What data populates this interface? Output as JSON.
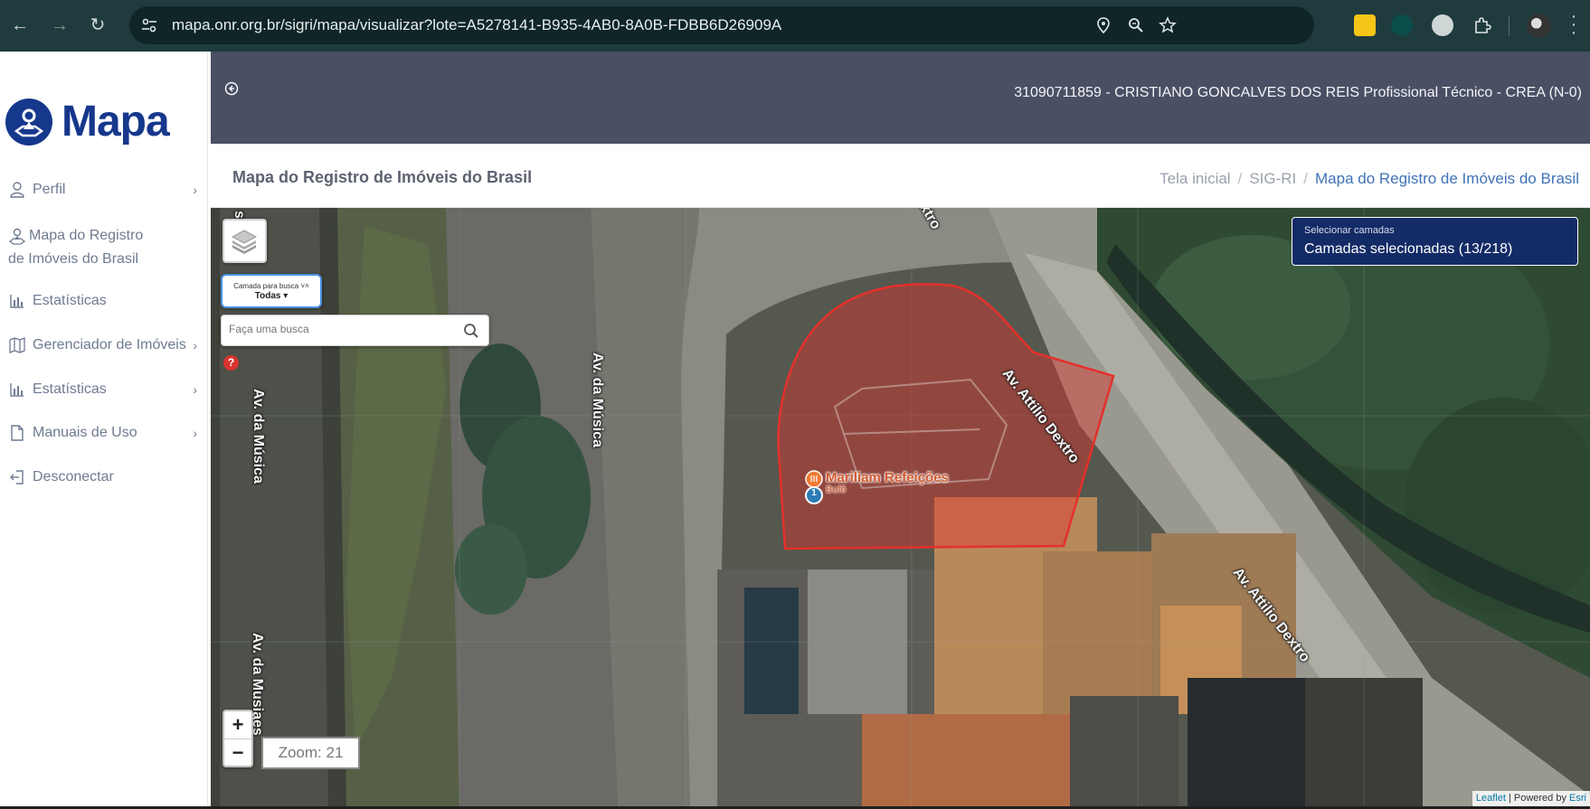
{
  "browser": {
    "url_host": "mapa.onr.org.br",
    "url_path": "/sigri/mapa/visualizar?lote=A5278141-B935-4AB0-8A0B-FDBB6D26909A"
  },
  "sidebar": {
    "logo_text": "Mapa",
    "items": [
      {
        "label": "Perfil",
        "icon": "user-icon",
        "has_chevron": true
      },
      {
        "label": "Mapa do Registro de Imóveis do Brasil",
        "icon": "map-pin-icon",
        "has_chevron": false
      },
      {
        "label": "Estatísticas",
        "icon": "bar-chart-icon",
        "has_chevron": false
      },
      {
        "label": "Gerenciador de Imóveis",
        "icon": "map-book-icon",
        "has_chevron": true
      },
      {
        "label": "Estatísticas",
        "icon": "bar-chart-icon",
        "has_chevron": true
      },
      {
        "label": "Manuais de Uso",
        "icon": "document-icon",
        "has_chevron": true
      },
      {
        "label": "Desconectar",
        "icon": "logout-icon",
        "has_chevron": false
      }
    ]
  },
  "topbar": {
    "user_info": "31090711859 - CRISTIANO GONCALVES DOS REIS Profissional Técnico - CREA (N-0)"
  },
  "header": {
    "page_title": "Mapa do Registro de Imóveis do Brasil",
    "breadcrumb": [
      "Tela inicial",
      "SIG-RI",
      "Mapa do Registro de Imóveis do Brasil"
    ]
  },
  "map": {
    "layer_select": {
      "label": "Camada para busca",
      "value": "Todas"
    },
    "search_placeholder": "Faça uma busca",
    "layers_panel": {
      "title": "Selecionar camadas",
      "value": "Camadas selecionadas (13/218)"
    },
    "zoom_in": "+",
    "zoom_out": "−",
    "zoom_level": "Zoom: 21",
    "road_labels": {
      "musica_left_top": "sica",
      "musica_center": "Av. da Música",
      "musica_left": "Av. da Música",
      "musica_left_bottom": "Av. da Musiaes",
      "dextro_top": "xtro",
      "dextro_mid": "Av. Attilio Dextro",
      "dextro_bottom": "Av. Attilio Dextro"
    },
    "poi": {
      "name": "Mariliam Refeições",
      "subtitle": "Bufê",
      "marker_number": "1"
    },
    "attribution": {
      "leaflet": "Leaflet",
      "rest": "| Powered by",
      "esri": "Esri"
    },
    "parcel_color": "#e4302b",
    "help_symbol": "?"
  }
}
